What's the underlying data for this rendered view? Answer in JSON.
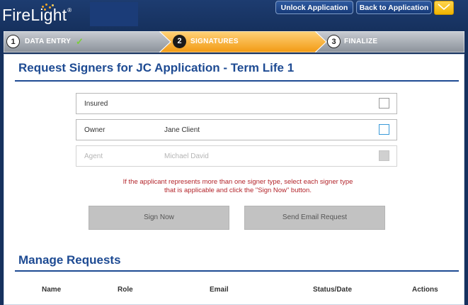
{
  "app": {
    "logo_text": "FireLight",
    "logo_trademark": "®"
  },
  "header": {
    "unlock_label": "Unlock Application",
    "back_label": "Back to Application",
    "mail_icon": "envelope-icon"
  },
  "steps": [
    {
      "number": "1",
      "label": "DATA ENTRY",
      "status": "complete",
      "check": "✓"
    },
    {
      "number": "2",
      "label": "SIGNATURES",
      "status": "active"
    },
    {
      "number": "3",
      "label": "FINALIZE",
      "status": "pending"
    }
  ],
  "main": {
    "title": "Request Signers for JC Application - Term Life 1",
    "signers": [
      {
        "type": "Insured",
        "name": "",
        "checked": false,
        "disabled": false
      },
      {
        "type": "Owner",
        "name": "Jane Client",
        "checked": false,
        "disabled": false
      },
      {
        "type": "Agent",
        "name": "Michael David",
        "checked": false,
        "disabled": true
      }
    ],
    "note_line1": "If the applicant represents more than one signer type, select each signer type",
    "note_line2": "that is applicable and click the \"Sign Now\" button.",
    "sign_now_label": "Sign Now",
    "send_email_label": "Send Email Request"
  },
  "manage": {
    "title": "Manage Requests",
    "columns": [
      "Name",
      "Role",
      "Email",
      "Status/Date",
      "Actions"
    ]
  },
  "colors": {
    "header_bg": "#16315e",
    "accent_blue": "#1e4b93",
    "active_step": "#f5a623",
    "note_red": "#b3252b"
  }
}
